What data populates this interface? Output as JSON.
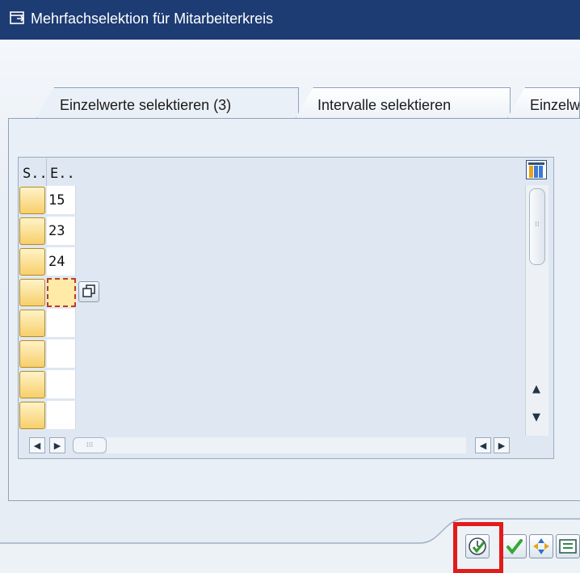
{
  "window": {
    "title": "Mehrfachselektion für Mitarbeiterkreis",
    "title_icon": "external-window-icon"
  },
  "tabs": [
    {
      "label": "Einzelwerte selektieren (3)",
      "active": true
    },
    {
      "label": "Intervalle selektieren",
      "active": false
    },
    {
      "label": "Einzelw",
      "active": false
    }
  ],
  "grid": {
    "columns": [
      {
        "label": "S.."
      },
      {
        "label": "E.."
      }
    ],
    "values": [
      "15",
      "23",
      "24",
      "",
      "",
      "",
      "",
      ""
    ],
    "focused_row": 4,
    "column_selection_icon": "column-layout-icon"
  },
  "colors": {
    "title_bar": "#1d3c73",
    "selection_button": "#f7cf6b",
    "highlight": "#e21b1b"
  },
  "toolbar": {
    "buttons": [
      {
        "name": "execute-icon",
        "highlighted": true
      },
      {
        "name": "checkmark-icon",
        "highlighted": false
      },
      {
        "name": "insert-line-icon",
        "highlighted": false
      },
      {
        "name": "delete-line-icon",
        "highlighted": false
      }
    ]
  }
}
